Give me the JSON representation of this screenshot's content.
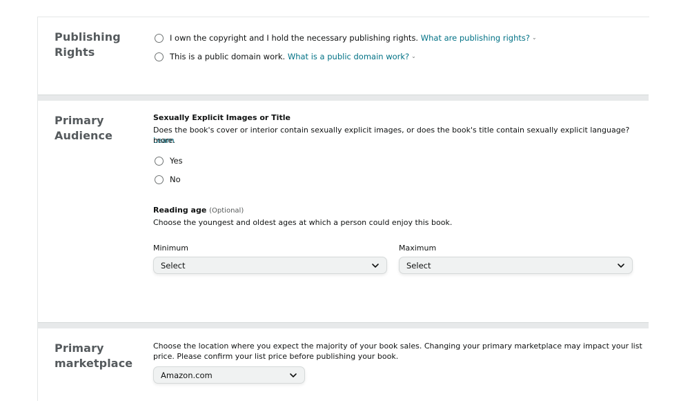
{
  "publishing_rights": {
    "title_line1": "Publishing",
    "title_line2": "Rights",
    "option_own": {
      "text": "I own the copyright and I hold the necessary publishing rights.",
      "link": "What are publishing rights?"
    },
    "option_public": {
      "text": "This is a public domain work.",
      "link": "What is a public domain work?"
    }
  },
  "primary_audience": {
    "title_line1": "Primary",
    "title_line2": "Audience",
    "explicit": {
      "heading": "Sexually Explicit Images or Title",
      "question": "Does the book's cover or interior contain sexually explicit images, or does the book's title contain sexually explicit language?",
      "learn_more_part1": "Learn",
      "learn_more_part2": "more.",
      "yes_label": "Yes",
      "no_label": "No"
    },
    "reading_age": {
      "heading": "Reading age",
      "optional": "(Optional)",
      "description": "Choose the youngest and oldest ages at which a person could enjoy this book.",
      "minimum_label": "Minimum",
      "minimum_value": "Select",
      "maximum_label": "Maximum",
      "maximum_value": "Select"
    }
  },
  "primary_marketplace": {
    "title_line1": "Primary",
    "title_line2": "marketplace",
    "description_line1": "Choose the location where you expect the majority of your book sales. Changing your primary marketplace may impact your list",
    "description_line2": "price. Please confirm your list price before publishing your book.",
    "selected": "Amazon.com"
  }
}
